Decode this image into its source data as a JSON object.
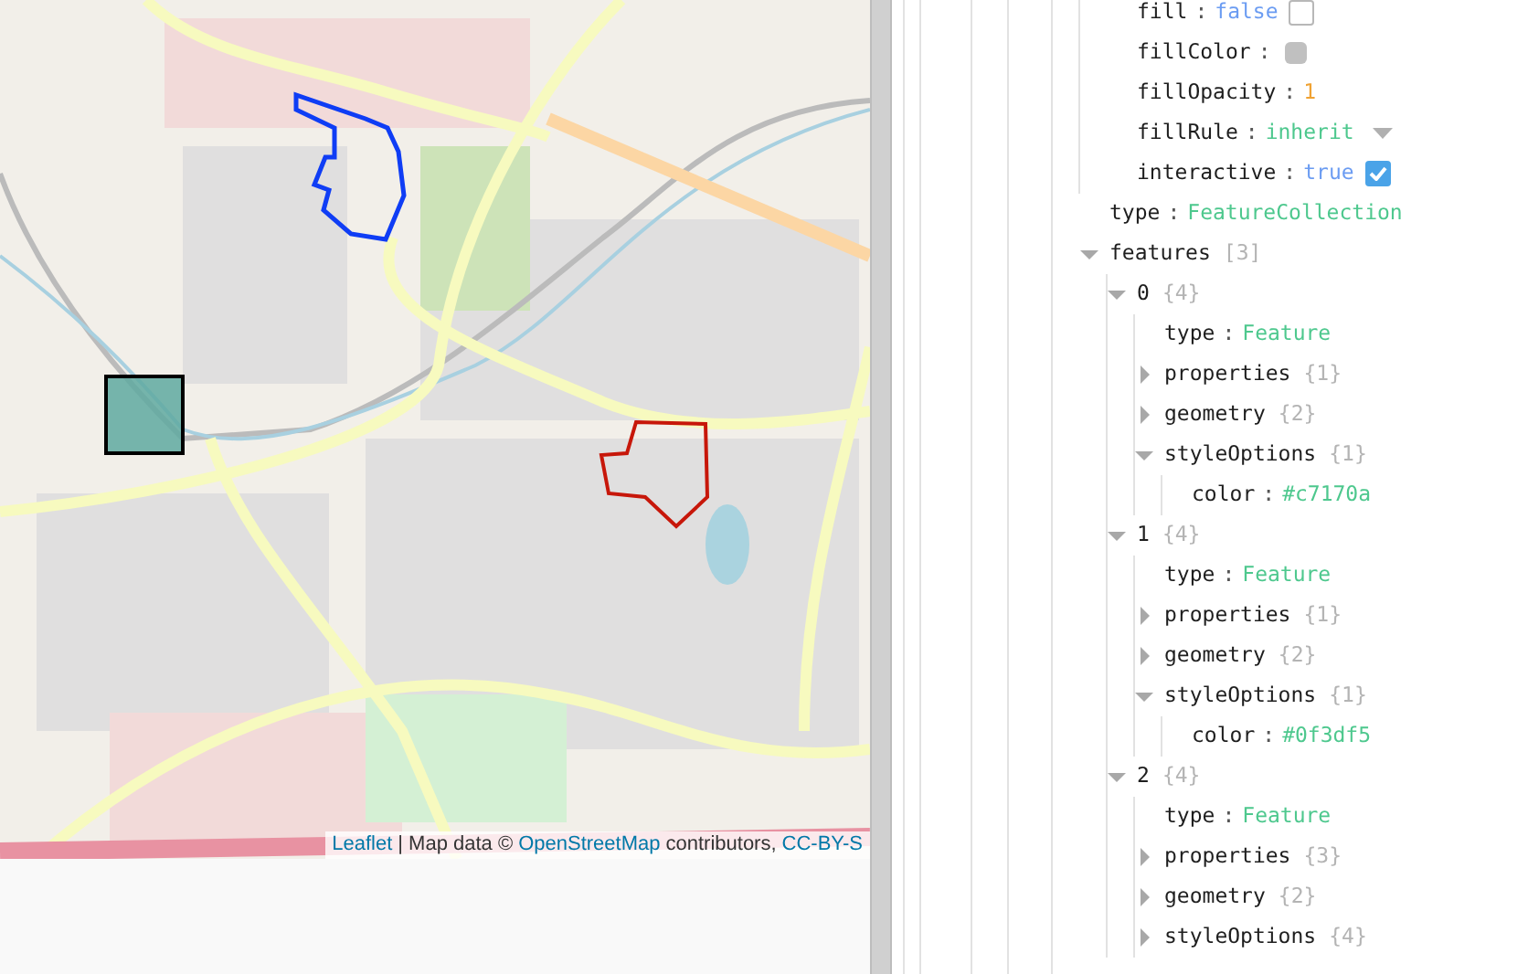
{
  "map": {
    "attribution": [
      {
        "kind": "link",
        "text": "Leaflet"
      },
      {
        "kind": "text",
        "text": "| Map data ©"
      },
      {
        "kind": "link",
        "text": "OpenStreetMap"
      },
      {
        "kind": "text",
        "text": "contributors,"
      },
      {
        "kind": "link",
        "text": "CC-BY-S"
      }
    ]
  },
  "inspector": {
    "style_options_tail": [
      {
        "key": "fill",
        "sep": ":",
        "kind": "boolean",
        "value": "false",
        "checked": false
      },
      {
        "key": "fillColor",
        "sep": ":",
        "kind": "swatch",
        "color": "#c0c0c0"
      },
      {
        "key": "fillOpacity",
        "sep": ":",
        "kind": "number",
        "value": "1"
      },
      {
        "key": "fillRule",
        "sep": ":",
        "kind": "select",
        "value": "inherit"
      },
      {
        "key": "interactive",
        "sep": ":",
        "kind": "boolean",
        "value": "true",
        "checked": true
      }
    ],
    "tree": [
      {
        "key": "type",
        "sep": ":",
        "kind": "string",
        "value": "FeatureCollection"
      },
      {
        "key": "features",
        "kind": "group",
        "count": "[3]",
        "expanded": true,
        "children": [
          {
            "key": "0",
            "kind": "group",
            "count": "{4}",
            "expanded": true,
            "children": [
              {
                "key": "type",
                "sep": ":",
                "kind": "string",
                "value": "Feature"
              },
              {
                "key": "properties",
                "kind": "group",
                "count": "{1}",
                "expanded": false
              },
              {
                "key": "geometry",
                "kind": "group",
                "count": "{2}",
                "expanded": false
              },
              {
                "key": "styleOptions",
                "kind": "group",
                "count": "{1}",
                "expanded": true,
                "children": [
                  {
                    "key": "color",
                    "sep": ":",
                    "kind": "string",
                    "value": "#c7170a"
                  }
                ]
              }
            ]
          },
          {
            "key": "1",
            "kind": "group",
            "count": "{4}",
            "expanded": true,
            "children": [
              {
                "key": "type",
                "sep": ":",
                "kind": "string",
                "value": "Feature"
              },
              {
                "key": "properties",
                "kind": "group",
                "count": "{1}",
                "expanded": false
              },
              {
                "key": "geometry",
                "kind": "group",
                "count": "{2}",
                "expanded": false
              },
              {
                "key": "styleOptions",
                "kind": "group",
                "count": "{1}",
                "expanded": true,
                "children": [
                  {
                    "key": "color",
                    "sep": ":",
                    "kind": "string",
                    "value": "#0f3df5"
                  }
                ]
              }
            ]
          },
          {
            "key": "2",
            "kind": "group",
            "count": "{4}",
            "expanded": true,
            "children": [
              {
                "key": "type",
                "sep": ":",
                "kind": "string",
                "value": "Feature"
              },
              {
                "key": "properties",
                "kind": "group",
                "count": "{3}",
                "expanded": false
              },
              {
                "key": "geometry",
                "kind": "group",
                "count": "{2}",
                "expanded": false
              },
              {
                "key": "styleOptions",
                "kind": "group",
                "count": "{4}",
                "expanded": false
              }
            ]
          }
        ]
      }
    ]
  }
}
